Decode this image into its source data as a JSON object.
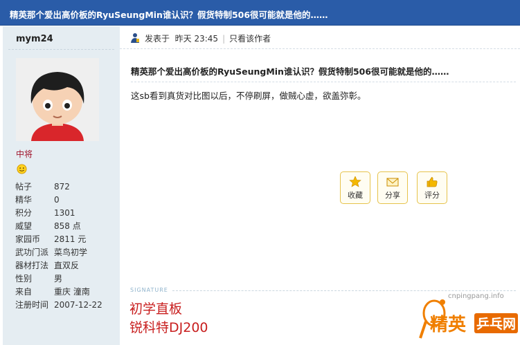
{
  "thread": {
    "title": "精英那个爱出高价板的RyuSeungMin谁认识？假货特制506很可能就是他的……"
  },
  "author": {
    "username": "mym24",
    "rank": "中将",
    "stats": [
      {
        "label": "帖子",
        "value": "872"
      },
      {
        "label": "精华",
        "value": "0"
      },
      {
        "label": "积分",
        "value": "1301"
      },
      {
        "label": "威望",
        "value": "858 点"
      },
      {
        "label": "家园币",
        "value": "2811 元"
      },
      {
        "label": "武功门派",
        "value": "菜鸟初学"
      },
      {
        "label": "器材打法",
        "value": "直双反"
      },
      {
        "label": "性别",
        "value": "男"
      },
      {
        "label": "来自",
        "value": "重庆  潼南"
      },
      {
        "label": "注册时间",
        "value": "2007-12-22"
      }
    ]
  },
  "post": {
    "posted_prefix": "发表于",
    "posted_time": "昨天 23:45",
    "separator": "|",
    "only_author_link": "只看该作者",
    "title": "精英那个爱出高价板的RyuSeungMin谁认识？假货特制506很可能就是他的……",
    "body": "这sb看到真货对比图以后，不停刷屏，做贼心虚，欲盖弥彰。"
  },
  "actions": {
    "favorite": "收藏",
    "share": "分享",
    "rate": "评分"
  },
  "signature": {
    "label": "SIGNATURE",
    "line1": "初学直板",
    "line2": "锐科特DJ200"
  },
  "watermark": {
    "url": "cnpingpang.info",
    "left_text": "精英",
    "right_text": "乒乓网"
  },
  "colors": {
    "titlebar": "#2a5ca8",
    "sidebar": "#e5edf2",
    "rank": "#a0142b",
    "signature": "#c81e1e",
    "action_border": "#e6c24a"
  }
}
